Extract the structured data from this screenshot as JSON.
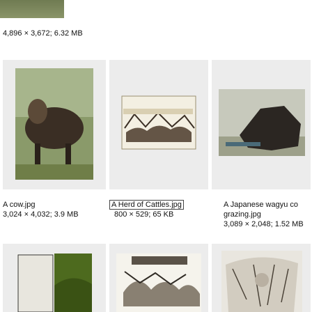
{
  "files": [
    {
      "name": "",
      "dims": "4,896 × 3,672; 6.32 MB"
    },
    {
      "name": "A cow.jpg",
      "dims": "3,024 × 4,032; 3.9 MB"
    },
    {
      "name": "A Herd of Cattles.jpg",
      "dims": "800 × 529; 65 KB"
    },
    {
      "name": "A Japanese wagyu cow grazing.jpg",
      "name_line1": "A Japanese wagyu co",
      "name_line2": "grazing.jpg",
      "dims": "3,089 × 2,048; 1.52 MB"
    }
  ]
}
